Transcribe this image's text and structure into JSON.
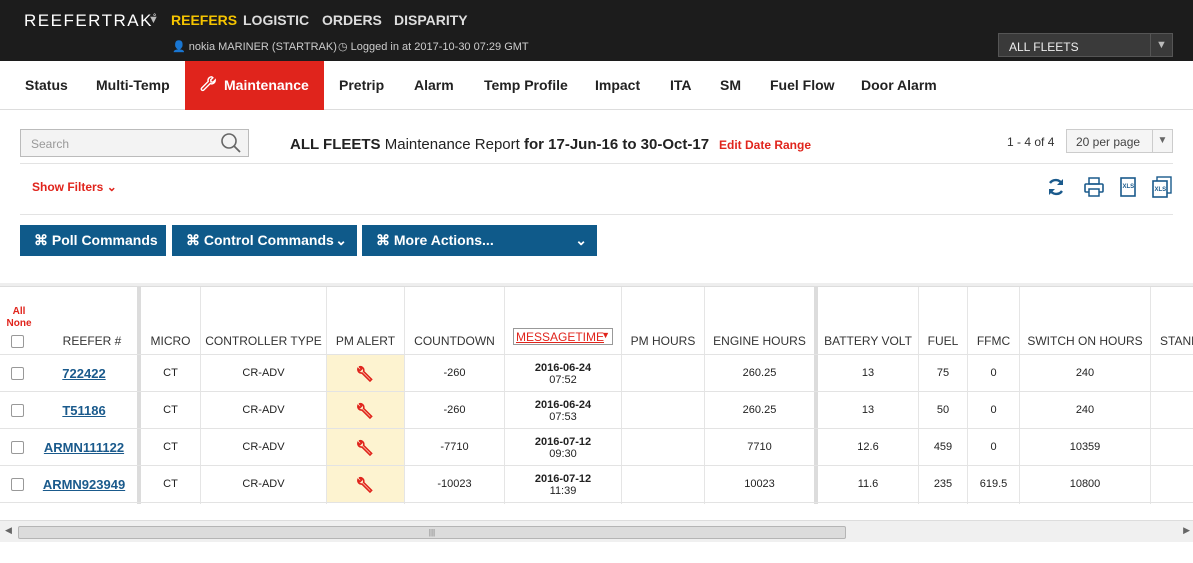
{
  "topbar": {
    "brand": "REEFERTRAK",
    "brand_mark": "°",
    "nav": [
      "REEFERS",
      "LOGISTIC",
      "ORDERS",
      "DISPARITY"
    ],
    "user": "nokia MARINER (STARTRAK)",
    "login": "Logged in at 2017-10-30 07:29 GMT",
    "fleet_select": "ALL FLEETS"
  },
  "tabs": [
    "Status",
    "Multi-Temp",
    "Maintenance",
    "Pretrip",
    "Alarm",
    "Temp Profile",
    "Impact",
    "ITA",
    "SM",
    "Fuel Flow",
    "Door Alarm"
  ],
  "toolbar": {
    "search_placeholder": "Search",
    "title_fleet": "ALL FLEETS",
    "title_report": "Maintenance Report",
    "title_range": "for 17-Jun-16 to 30-Oct-17",
    "edit_range": "Edit Date Range",
    "count": "1 - 4 of 4",
    "per_page": "20 per page",
    "show_filters": "Show Filters"
  },
  "actions": {
    "poll": "⌘ Poll Commands",
    "control": "⌘ Control Commands",
    "more": "⌘ More Actions..."
  },
  "table": {
    "all": "All",
    "none": "None",
    "headers": [
      "REEFER #",
      "MICRO",
      "CONTROLLER TYPE",
      "PM ALERT",
      "COUNTDOWN",
      "MESSAGETIME",
      "PM HOURS",
      "ENGINE HOURS",
      "BATTERY VOLT",
      "FUEL",
      "FFMC",
      "SWITCH ON HOURS",
      "STAND"
    ],
    "rows": [
      {
        "reefer": "722422",
        "micro": "CT",
        "controller": "CR-ADV",
        "countdown": "-260",
        "date": "2016-06-24",
        "time": "07:52",
        "pm_hours": "",
        "engine": "260.25",
        "battery": "13",
        "fuel": "75",
        "ffmc": "0",
        "switch_on": "240"
      },
      {
        "reefer": "T51186",
        "micro": "CT",
        "controller": "CR-ADV",
        "countdown": "-260",
        "date": "2016-06-24",
        "time": "07:53",
        "pm_hours": "",
        "engine": "260.25",
        "battery": "13",
        "fuel": "50",
        "ffmc": "0",
        "switch_on": "240"
      },
      {
        "reefer": "ARMN111122",
        "micro": "CT",
        "controller": "CR-ADV",
        "countdown": "-7710",
        "date": "2016-07-12",
        "time": "09:30",
        "pm_hours": "",
        "engine": "7710",
        "battery": "12.6",
        "fuel": "459",
        "ffmc": "0",
        "switch_on": "10359"
      },
      {
        "reefer": "ARMN923949",
        "micro": "CT",
        "controller": "CR-ADV",
        "countdown": "-10023",
        "date": "2016-07-12",
        "time": "11:39",
        "pm_hours": "",
        "engine": "10023",
        "battery": "11.6",
        "fuel": "235",
        "ffmc": "619.5",
        "switch_on": "10800"
      }
    ]
  },
  "colors": {
    "accent_red": "#e0241c",
    "nav_yellow": "#f5c400",
    "action_blue": "#0f5a8a",
    "link_blue": "#1a5a8c",
    "pm_alert_bg": "#fdf3d0"
  }
}
